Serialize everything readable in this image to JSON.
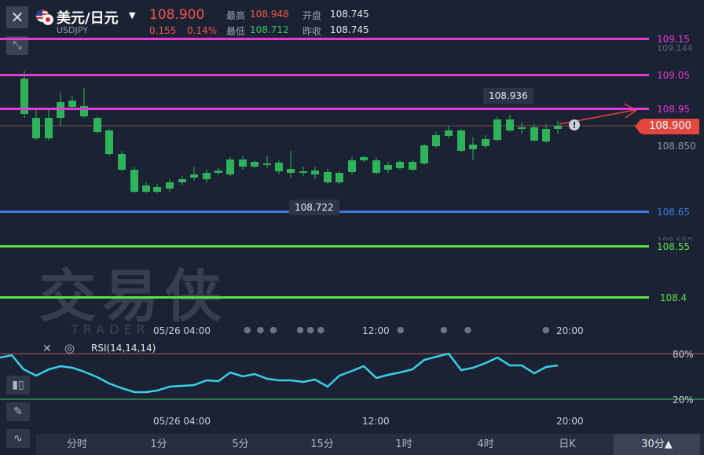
{
  "header": {
    "title": "美元/日元",
    "symbol": "USDJPY",
    "price": "108.900",
    "change": "0.155",
    "change_pct": "0.14%",
    "high_label": "最高",
    "high": "108.948",
    "low_label": "最低",
    "low": "108.712",
    "open_label": "开盘",
    "open": "108.745",
    "prev_close_label": "昨收",
    "prev_close": "108.745"
  },
  "levels": {
    "l1": {
      "label": "109.15",
      "color": "#e43ad8"
    },
    "l2": {
      "label": "109.05",
      "color": "#e43ad8"
    },
    "l3": {
      "label": "108.95",
      "color": "#e43ad8"
    },
    "l4": {
      "label": "108.65",
      "color": "#3f7be6"
    },
    "l5": {
      "label": "108.55",
      "color": "#5ee04a"
    },
    "l6": {
      "label": "108.4",
      "color": "#5ee04a"
    }
  },
  "axis_ghost": {
    "a": "109.144",
    "b": "108.850",
    "c": "108.550"
  },
  "current_price_tag": "108.900",
  "callouts": {
    "high": "108.936",
    "low": "108.722"
  },
  "time_labels": {
    "t1": "05/26 04:00",
    "t2": "12:00",
    "t3": "20:00"
  },
  "watermark": {
    "cn": "交易侠",
    "en": "TRADER"
  },
  "rsi": {
    "title": "RSI(14,14,14)",
    "upper": "80%",
    "lower": "20%"
  },
  "tabs": [
    "分时",
    "1分",
    "5分",
    "15分",
    "1时",
    "4时",
    "日K",
    "30分▲"
  ],
  "colors": {
    "up": "#f0564a",
    "down": "#2fb35a",
    "bg": "#1b2233"
  }
}
